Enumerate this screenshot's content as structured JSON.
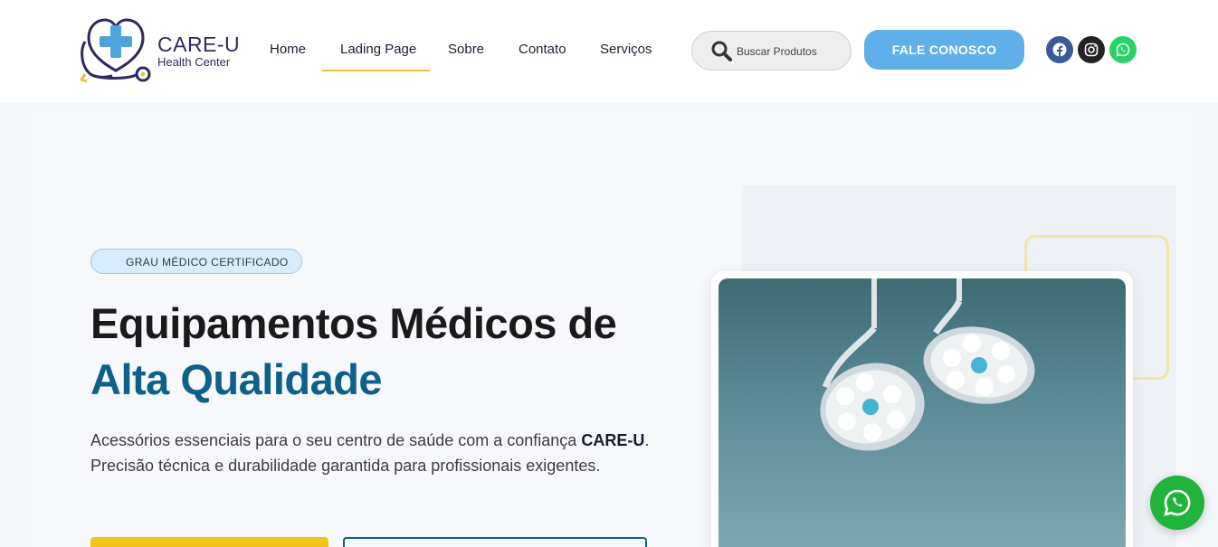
{
  "brand": {
    "name": "CARE-U",
    "tagline": "Health Center"
  },
  "nav": {
    "items": [
      {
        "label": "Home"
      },
      {
        "label": "Lading Page"
      },
      {
        "label": "Sobre"
      },
      {
        "label": "Contato"
      },
      {
        "label": "Serviços"
      }
    ],
    "active_index": 1
  },
  "search": {
    "placeholder": "Buscar Produtos"
  },
  "cta": {
    "label": "FALE CONOSCO"
  },
  "social": {
    "icons": [
      "facebook-icon",
      "instagram-icon",
      "whatsapp-icon"
    ]
  },
  "hero": {
    "badge": "GRAU MÉDICO CERTIFICADO",
    "title_line1": "Equipamentos Médicos de",
    "title_line2": "Alta Qualidade",
    "desc_part1": "Acessórios essenciais para o seu centro de saúde com a confiança",
    "desc_brand": "CARE-U",
    "desc_part2": ". Precisão técnica e durabilidade garantida para profissionais exigentes."
  },
  "colors": {
    "accent_blue": "#0d6089",
    "cta_blue": "#5fb0e8",
    "yellow": "#f2c31a",
    "whatsapp_green": "#21b33b",
    "brand_navy": "#2d2a5e"
  }
}
